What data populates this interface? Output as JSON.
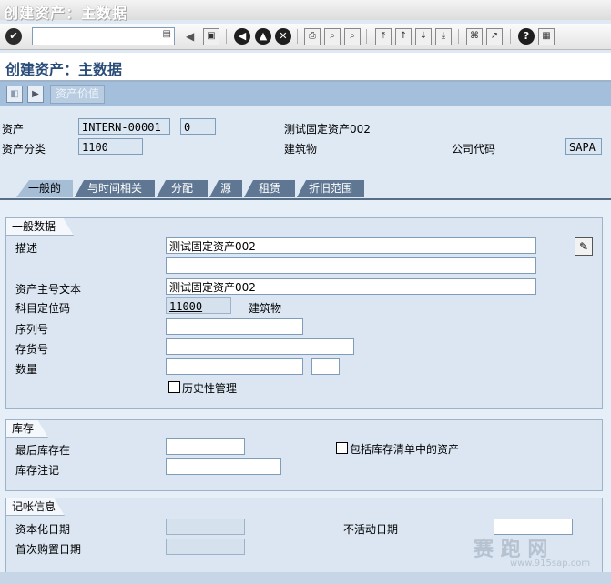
{
  "window_title": "创建资产：主数据",
  "page_title": "创建资产：主数据",
  "app_toolbar": {
    "asset_value_label": "资产价值"
  },
  "header": {
    "asset_label": "资产",
    "asset_number": "INTERN-00001",
    "sub_number": "0",
    "asset_description": "测试固定资产002",
    "asset_class_label": "资产分类",
    "asset_class": "1100",
    "asset_class_desc": "建筑物",
    "company_code_label": "公司代码",
    "company_code": "SAPA"
  },
  "tabs": [
    {
      "label": "一般的",
      "active": true
    },
    {
      "label": "与时间相关",
      "active": false
    },
    {
      "label": "分配",
      "active": false
    },
    {
      "label": "源",
      "active": false
    },
    {
      "label": "租赁",
      "active": false
    },
    {
      "label": "折旧范围",
      "active": false
    }
  ],
  "general": {
    "title": "一般数据",
    "description_label": "描述",
    "description_1": "测试固定资产002",
    "description_2": "",
    "main_text_label": "资产主号文本",
    "main_text": "测试固定资产002",
    "account_det_label": "科目定位码",
    "account_det": "11000",
    "account_det_desc": "建筑物",
    "serial_label": "序列号",
    "serial": "",
    "inventory_label": "存货号",
    "inventory": "",
    "quantity_label": "数量",
    "quantity": "",
    "unit": "",
    "history_label": "历史性管理"
  },
  "stock": {
    "title": "库存",
    "last_inventory_label": "最后库存在",
    "last_inventory": "",
    "include_label": "包括库存清单中的资产",
    "inventory_note_label": "库存注记",
    "inventory_note": ""
  },
  "posting": {
    "title": "记帐信息",
    "cap_date_label": "资本化日期",
    "cap_date": "",
    "deact_date_label": "不活动日期",
    "deact_date": "",
    "first_acq_label": "首次购置日期",
    "first_acq": ""
  },
  "watermark": {
    "text": "赛 跑 网",
    "url": "www.915sap.com"
  },
  "colors": {
    "title_blue": "#2a4c79",
    "tab_dark": "#5f7792",
    "tab_active": "#a6bdd6",
    "group_bg": "#dbe6f2"
  }
}
